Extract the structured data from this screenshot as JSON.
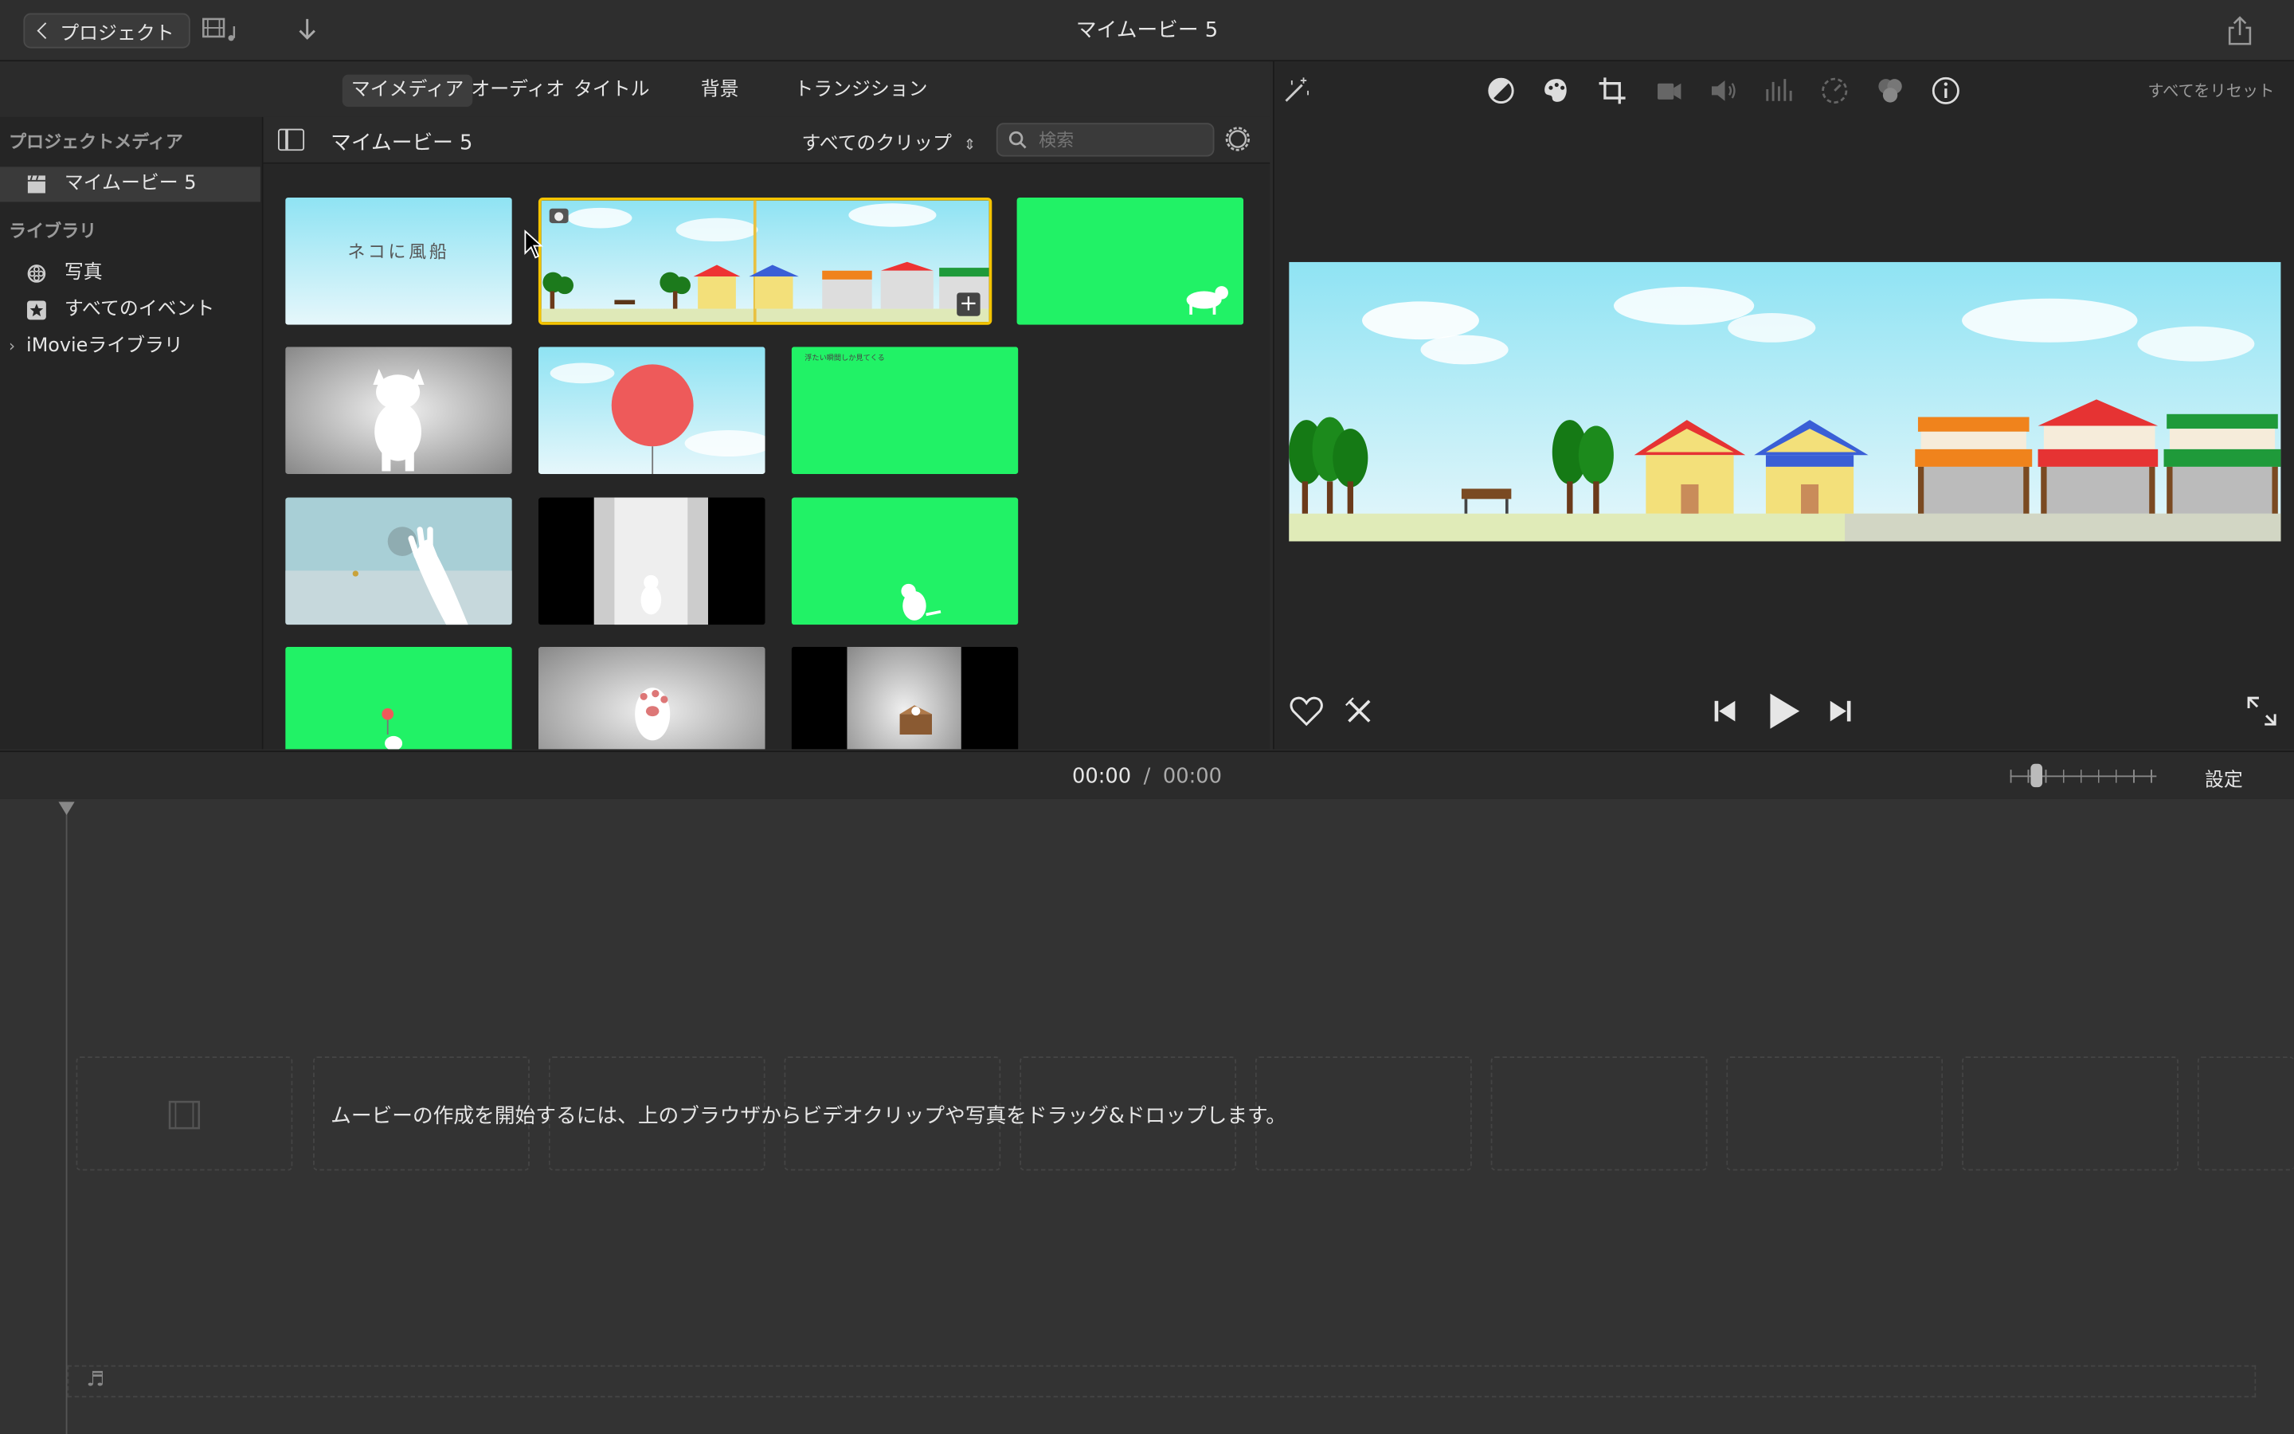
{
  "toolbar": {
    "back_label": "プロジェクト",
    "window_title": "マイムービー 5"
  },
  "browser_tabs": [
    {
      "label": "マイメディア",
      "active": true
    },
    {
      "label": "オーディオ",
      "active": false
    },
    {
      "label": "タイトル",
      "active": false
    },
    {
      "label": "背景",
      "active": false
    },
    {
      "label": "トランジション",
      "active": false
    }
  ],
  "sidebar": {
    "section_project": "プロジェクトメディア",
    "project_item": "マイムービー 5",
    "section_library": "ライブラリ",
    "library_items": [
      {
        "label": "写真",
        "icon": "photos-icon"
      },
      {
        "label": "すべてのイベント",
        "icon": "star-icon"
      }
    ],
    "imovie_library": "iMovieライブラリ"
  },
  "content_header": {
    "title": "マイムービー 5",
    "filter_label": "すべてのクリップ",
    "search_placeholder": "検索"
  },
  "clips": {
    "clip1_text": "ネコに風船",
    "clip6_text": "浮たい瞬間しか見てくる"
  },
  "viewer": {
    "reset_label": "すべてをリセット"
  },
  "timeline": {
    "current_time": "00:00",
    "separator": "/",
    "total_time": "00:00",
    "settings_label": "設定",
    "drop_hint": "ムービーの作成を開始するには、上のブラウザからビデオクリップや写真をドラッグ&ドロップします。"
  },
  "colors": {
    "green_screen": "#21f266",
    "selection": "#f5c400",
    "accent_sky": "#9fe6f2"
  }
}
